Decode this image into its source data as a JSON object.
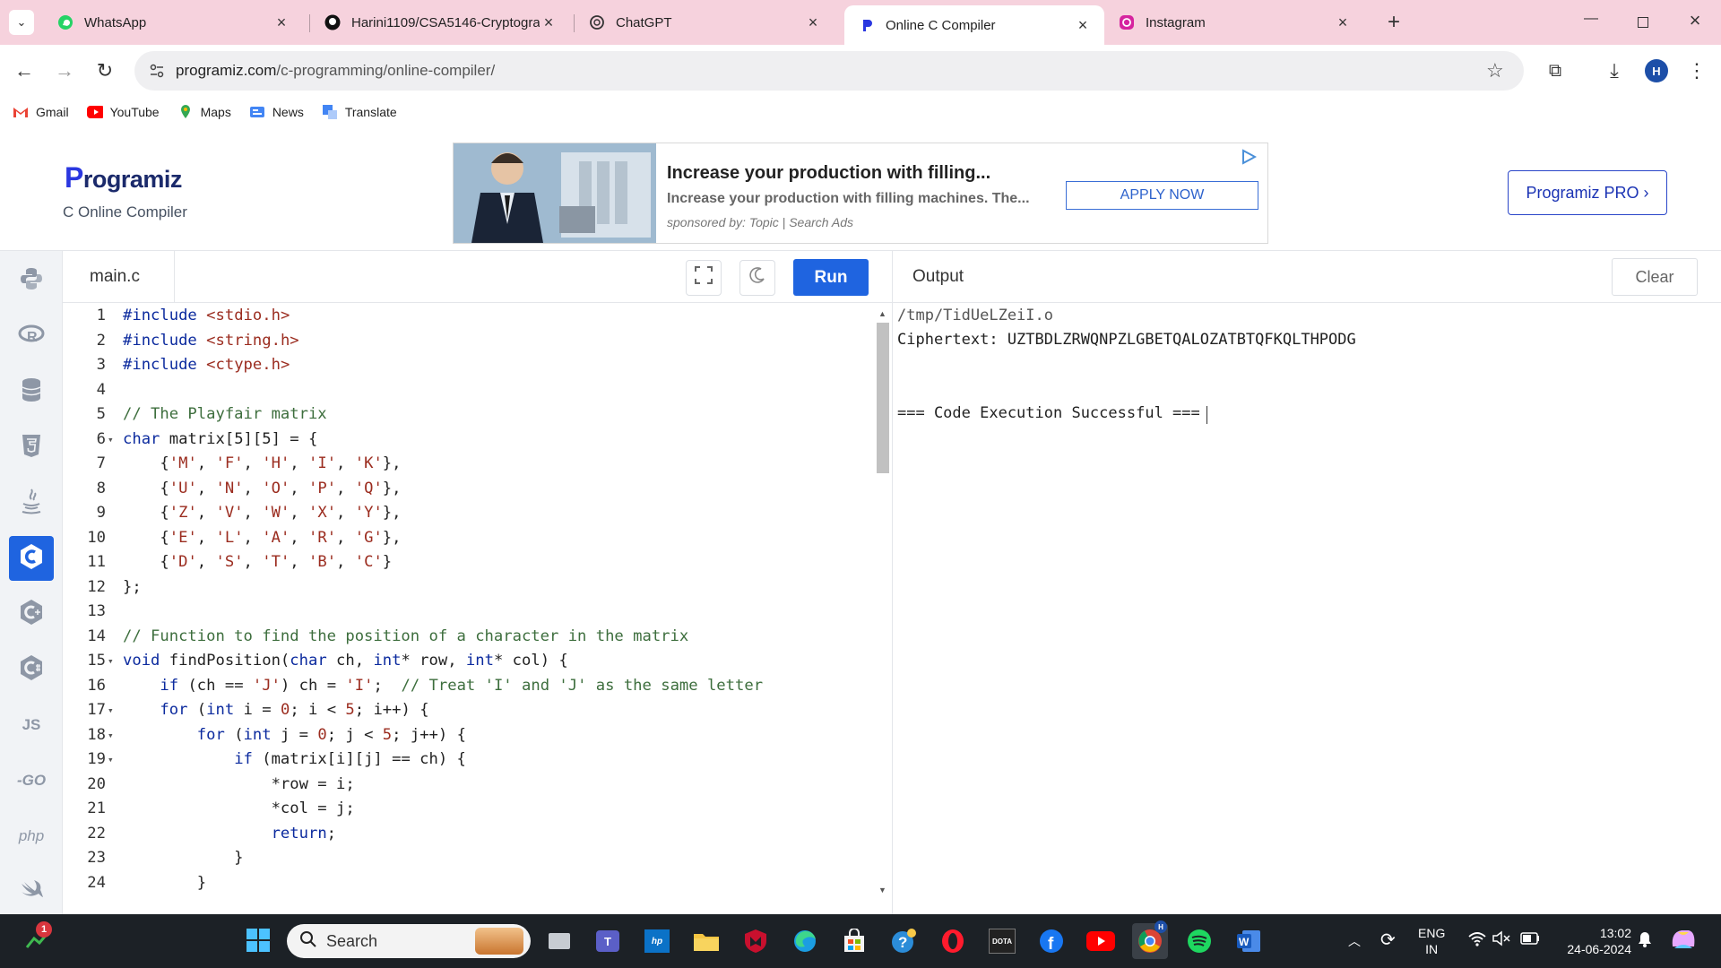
{
  "browser": {
    "tabs": [
      {
        "title": "WhatsApp",
        "active": false
      },
      {
        "title": "Harini1109/CSA5146-Cryptogra",
        "active": false
      },
      {
        "title": "ChatGPT",
        "active": false
      },
      {
        "title": "Online C Compiler",
        "active": true
      },
      {
        "title": "Instagram",
        "active": false
      }
    ],
    "url_host": "programiz.com",
    "url_path": "/c-programming/online-compiler/",
    "profile_initial": "H",
    "bookmarks": [
      "Gmail",
      "YouTube",
      "Maps",
      "News",
      "Translate"
    ]
  },
  "site": {
    "logo_text": "rogramiz",
    "logo_letter": "P",
    "subtitle": "C Online Compiler",
    "pro_button": "Programiz PRO ›"
  },
  "ad": {
    "headline": "Increase your production with filling...",
    "description": "Increase your production with filling machines. The...",
    "sponsor": "sponsored by: Topic | Search Ads",
    "cta": "APPLY NOW"
  },
  "editor": {
    "filename": "main.c",
    "run_label": "Run",
    "lines": [
      {
        "n": "1",
        "fold": "",
        "html": "<span class='kw'>#include</span> <span class='str'>&lt;stdio.h&gt;</span>"
      },
      {
        "n": "2",
        "fold": "",
        "html": "<span class='kw'>#include</span> <span class='str'>&lt;string.h&gt;</span>"
      },
      {
        "n": "3",
        "fold": "",
        "html": "<span class='kw'>#include</span> <span class='str'>&lt;ctype.h&gt;</span>"
      },
      {
        "n": "4",
        "fold": "",
        "html": ""
      },
      {
        "n": "5",
        "fold": "",
        "html": "<span class='cm'>// The Playfair matrix</span>"
      },
      {
        "n": "6",
        "fold": "▾",
        "html": "<span class='kw'>char</span> matrix[5][5] = {"
      },
      {
        "n": "7",
        "fold": "",
        "html": "    {<span class='str'>'M'</span>, <span class='str'>'F'</span>, <span class='str'>'H'</span>, <span class='str'>'I'</span>, <span class='str'>'K'</span>},"
      },
      {
        "n": "8",
        "fold": "",
        "html": "    {<span class='str'>'U'</span>, <span class='str'>'N'</span>, <span class='str'>'O'</span>, <span class='str'>'P'</span>, <span class='str'>'Q'</span>},"
      },
      {
        "n": "9",
        "fold": "",
        "html": "    {<span class='str'>'Z'</span>, <span class='str'>'V'</span>, <span class='str'>'W'</span>, <span class='str'>'X'</span>, <span class='str'>'Y'</span>},"
      },
      {
        "n": "10",
        "fold": "",
        "html": "    {<span class='str'>'E'</span>, <span class='str'>'L'</span>, <span class='str'>'A'</span>, <span class='str'>'R'</span>, <span class='str'>'G'</span>},"
      },
      {
        "n": "11",
        "fold": "",
        "html": "    {<span class='str'>'D'</span>, <span class='str'>'S'</span>, <span class='str'>'T'</span>, <span class='str'>'B'</span>, <span class='str'>'C'</span>}"
      },
      {
        "n": "12",
        "fold": "",
        "html": "};"
      },
      {
        "n": "13",
        "fold": "",
        "html": ""
      },
      {
        "n": "14",
        "fold": "",
        "html": "<span class='cm'>// Function to find the position of a character in the matrix</span>"
      },
      {
        "n": "15",
        "fold": "▾",
        "html": "<span class='kw'>void</span> findPosition(<span class='kw'>char</span> ch, <span class='kw'>int</span>* row, <span class='kw'>int</span>* col) {"
      },
      {
        "n": "16",
        "fold": "",
        "html": "    <span class='kw'>if</span> (ch == <span class='str'>'J'</span>) ch = <span class='str'>'I'</span>;  <span class='cm'>// Treat 'I' and 'J' as the same letter</span>"
      },
      {
        "n": "17",
        "fold": "▾",
        "html": "    <span class='kw'>for</span> (<span class='kw'>int</span> i = <span class='str'>0</span>; i &lt; <span class='str'>5</span>; i++) {"
      },
      {
        "n": "18",
        "fold": "▾",
        "html": "        <span class='kw'>for</span> (<span class='kw'>int</span> j = <span class='str'>0</span>; j &lt; <span class='str'>5</span>; j++) {"
      },
      {
        "n": "19",
        "fold": "▾",
        "html": "            <span class='kw'>if</span> (matrix[i][j] == ch) {"
      },
      {
        "n": "20",
        "fold": "",
        "html": "                *row = i;"
      },
      {
        "n": "21",
        "fold": "",
        "html": "                *col = j;"
      },
      {
        "n": "22",
        "fold": "",
        "html": "                <span class='kw'>return</span>;"
      },
      {
        "n": "23",
        "fold": "",
        "html": "            }"
      },
      {
        "n": "24",
        "fold": "",
        "html": "        }"
      }
    ]
  },
  "output": {
    "title": "Output",
    "clear_label": "Clear",
    "lines": [
      "/tmp/TidUeLZeiI.o",
      "Ciphertext: UZTBDLZRWQNPZLGBETQALOZATBTQFKQLTHPODG",
      "",
      "",
      "=== Code Execution Successful ==="
    ]
  },
  "rail": {
    "items": [
      {
        "name": "python",
        "label": ""
      },
      {
        "name": "r",
        "label": ""
      },
      {
        "name": "sql",
        "label": ""
      },
      {
        "name": "html",
        "label": ""
      },
      {
        "name": "java",
        "label": ""
      },
      {
        "name": "c",
        "label": ""
      },
      {
        "name": "cpp",
        "label": ""
      },
      {
        "name": "csharp",
        "label": ""
      },
      {
        "name": "javascript",
        "label": "JS"
      },
      {
        "name": "go",
        "label": "-GO"
      },
      {
        "name": "php",
        "label": "php"
      },
      {
        "name": "swift",
        "label": ""
      }
    ]
  },
  "taskbar": {
    "search_placeholder": "Search",
    "notification_count": "1",
    "lang_line1": "ENG",
    "lang_line2": "IN",
    "time": "13:02",
    "date": "24-06-2024"
  }
}
